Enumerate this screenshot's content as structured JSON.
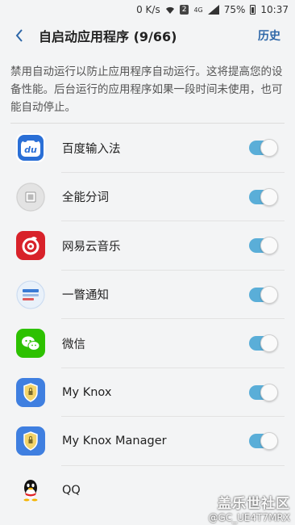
{
  "status_bar": {
    "speed": "0 K/s",
    "badge": "2",
    "network": "4G",
    "battery": "75%",
    "time": "10:37"
  },
  "header": {
    "title": "自启动应用程序 (9/66)",
    "history_label": "历史"
  },
  "description": "禁用自动运行以防止应用程序自动运行。这将提高您的设备性能。后台运行的应用程序如果一段时间未使用，也可能自动停止。",
  "apps": [
    {
      "name": "百度输入法",
      "enabled": true,
      "icon": "baidu-input-icon"
    },
    {
      "name": "全能分词",
      "enabled": true,
      "icon": "word-split-icon"
    },
    {
      "name": "网易云音乐",
      "enabled": true,
      "icon": "netease-music-icon"
    },
    {
      "name": "一瞥通知",
      "enabled": true,
      "icon": "glance-notify-icon"
    },
    {
      "name": "微信",
      "enabled": true,
      "icon": "wechat-icon"
    },
    {
      "name": "My Knox",
      "enabled": true,
      "icon": "knox-icon"
    },
    {
      "name": "My Knox Manager",
      "enabled": true,
      "icon": "knox-manager-icon"
    },
    {
      "name": "QQ",
      "enabled": true,
      "icon": "qq-icon"
    }
  ],
  "watermark": {
    "line1": "盖乐世社区",
    "line2": "@GC_UE4T7MRX"
  }
}
